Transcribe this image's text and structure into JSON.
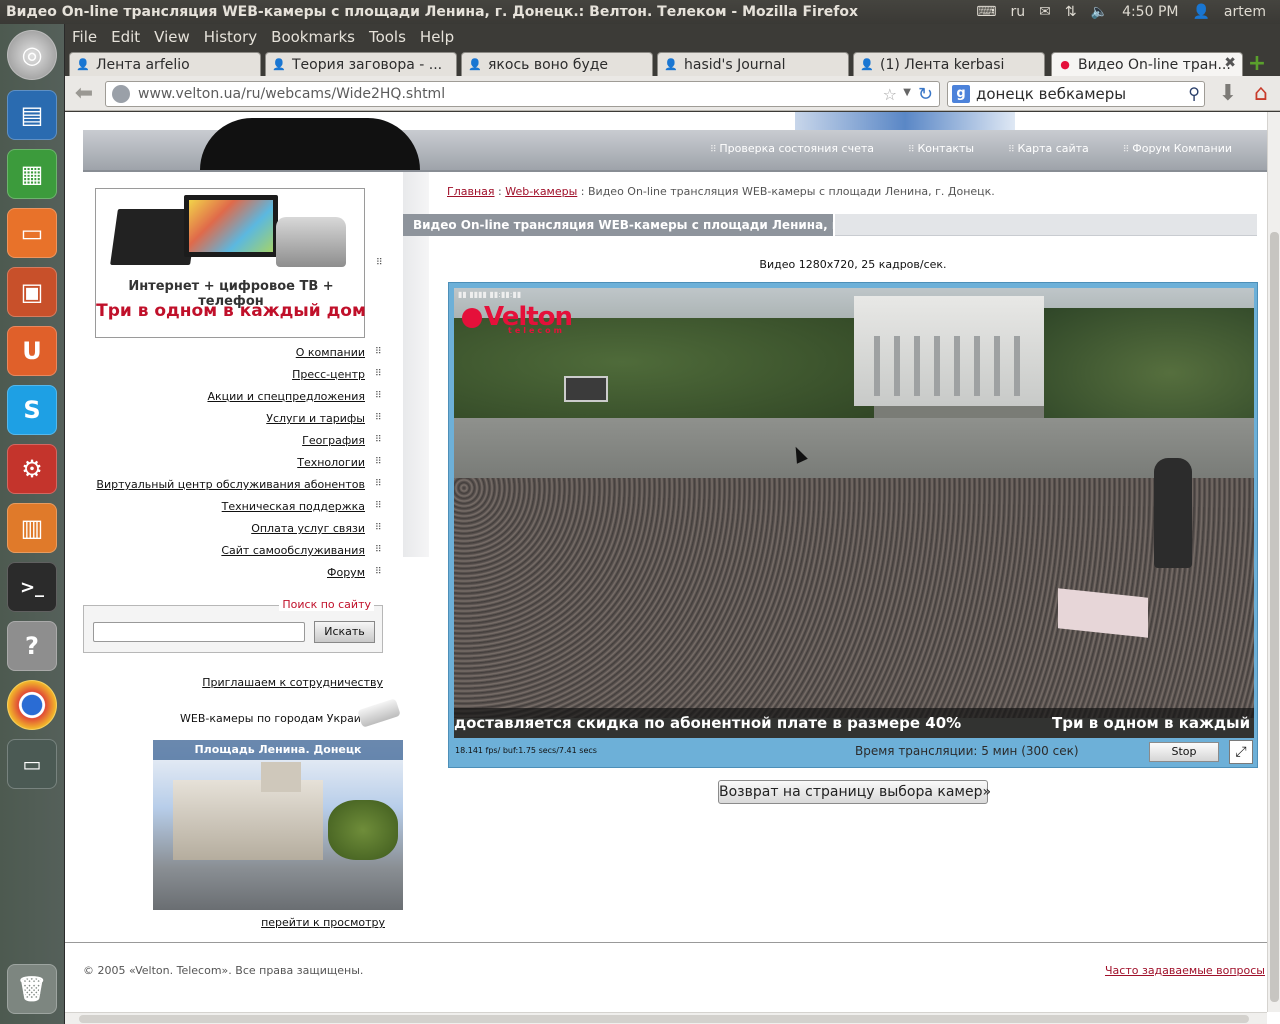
{
  "window": {
    "title": "Видео On-line трансляция WEB-камеры с площади Ленина, г. Донецк.: Велтон. Телеком - Mozilla Firefox"
  },
  "tray": {
    "language": "ru",
    "time": "4:50 PM",
    "user": "artem"
  },
  "menu": [
    "File",
    "Edit",
    "View",
    "History",
    "Bookmarks",
    "Tools",
    "Help"
  ],
  "tabs": [
    {
      "label": "Лента arfelio"
    },
    {
      "label": "Теория заговора - ..."
    },
    {
      "label": "якось воно буде"
    },
    {
      "label": "hasid's Journal"
    },
    {
      "label": "(1) Лента kerbasi"
    },
    {
      "label": "Видео On-line тран...",
      "active": true
    }
  ],
  "nav": {
    "url": "www.velton.ua/ru/webcams/Wide2HQ.shtml",
    "search_value": "донецк вебкамеры"
  },
  "page": {
    "top_nav": [
      "Проверка состояния счета",
      "Контакты",
      "Карта сайта",
      "Форум Компании"
    ],
    "promo": {
      "line1": "Интернет + цифровое ТВ + телефон",
      "line2": "Три в одном в каждый дом"
    },
    "left_menu": [
      "О компании",
      "Пресс-центр",
      "Акции и спецпредложения",
      "Услуги и тарифы",
      "География",
      "Технологии",
      "Виртуальный центр обслуживания абонентов",
      "Техническая поддержка",
      "Оплата услуг связи",
      "Сайт самообслуживания",
      "Форум"
    ],
    "site_search": {
      "legend": "Поиск по сайту",
      "button": "Искать",
      "value": ""
    },
    "invite": "Приглашаем к сотрудничеству",
    "webcams_title": "WEB-камеры по городам Украины",
    "thumb_title": "Площадь Ленина. Донецк",
    "thumb_link": "перейти к просмотру",
    "breadcrumb": {
      "home": "Главная",
      "sep": " : ",
      "section": "Web-камеры",
      "current": "Видео On-line трансляция WEB-камеры с площади Ленина, г. Донецк."
    },
    "heading": "Видео On-line трансляция WEB-камеры с площади Ленина, г. Донецк.",
    "video_meta": "Видео 1280x720, 25 кадров/сек.",
    "player": {
      "logo": "Velton",
      "logo_sub": "telecom",
      "ticker_left": "доставляется скидка по абонентной плате в размере 40%",
      "ticker_right": "Три в одном в каждый д",
      "fps": "18.141 fps/ buf:1.75 secs/7.41 secs",
      "duration": "Время трансляции: 5 мин (300 сек)",
      "stop": "Stop"
    },
    "return_button": "Возврат на страницу выбора камер»",
    "copyright": "© 2005 «Velton. Telecom». Все права защищены.",
    "faq": "Часто задаваемые вопросы"
  }
}
